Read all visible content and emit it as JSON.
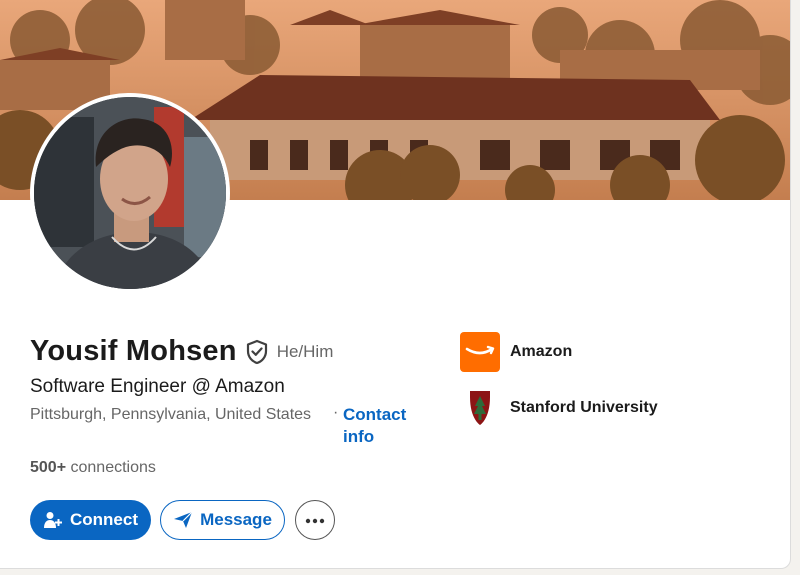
{
  "profile": {
    "name": "Yousif Mohsen",
    "pronouns": "He/Him",
    "headline": "Software Engineer @ Amazon",
    "location": "Pittsburgh, Pennsylvania, United States",
    "location_separator": "·",
    "contact_info": "Contact info",
    "connections_count": "500+",
    "connections_label": " connections"
  },
  "actions": {
    "connect": "Connect",
    "message": "Message",
    "more_icon": "ellipsis-icon"
  },
  "orgs": [
    {
      "name": "Amazon",
      "logo_color": "#ff6d00"
    },
    {
      "name": "Stanford University",
      "logo_color": "#8c1515"
    }
  ],
  "colors": {
    "primary": "#0a66c2",
    "text_primary": "#1b1b1b",
    "text_secondary": "#666666"
  }
}
